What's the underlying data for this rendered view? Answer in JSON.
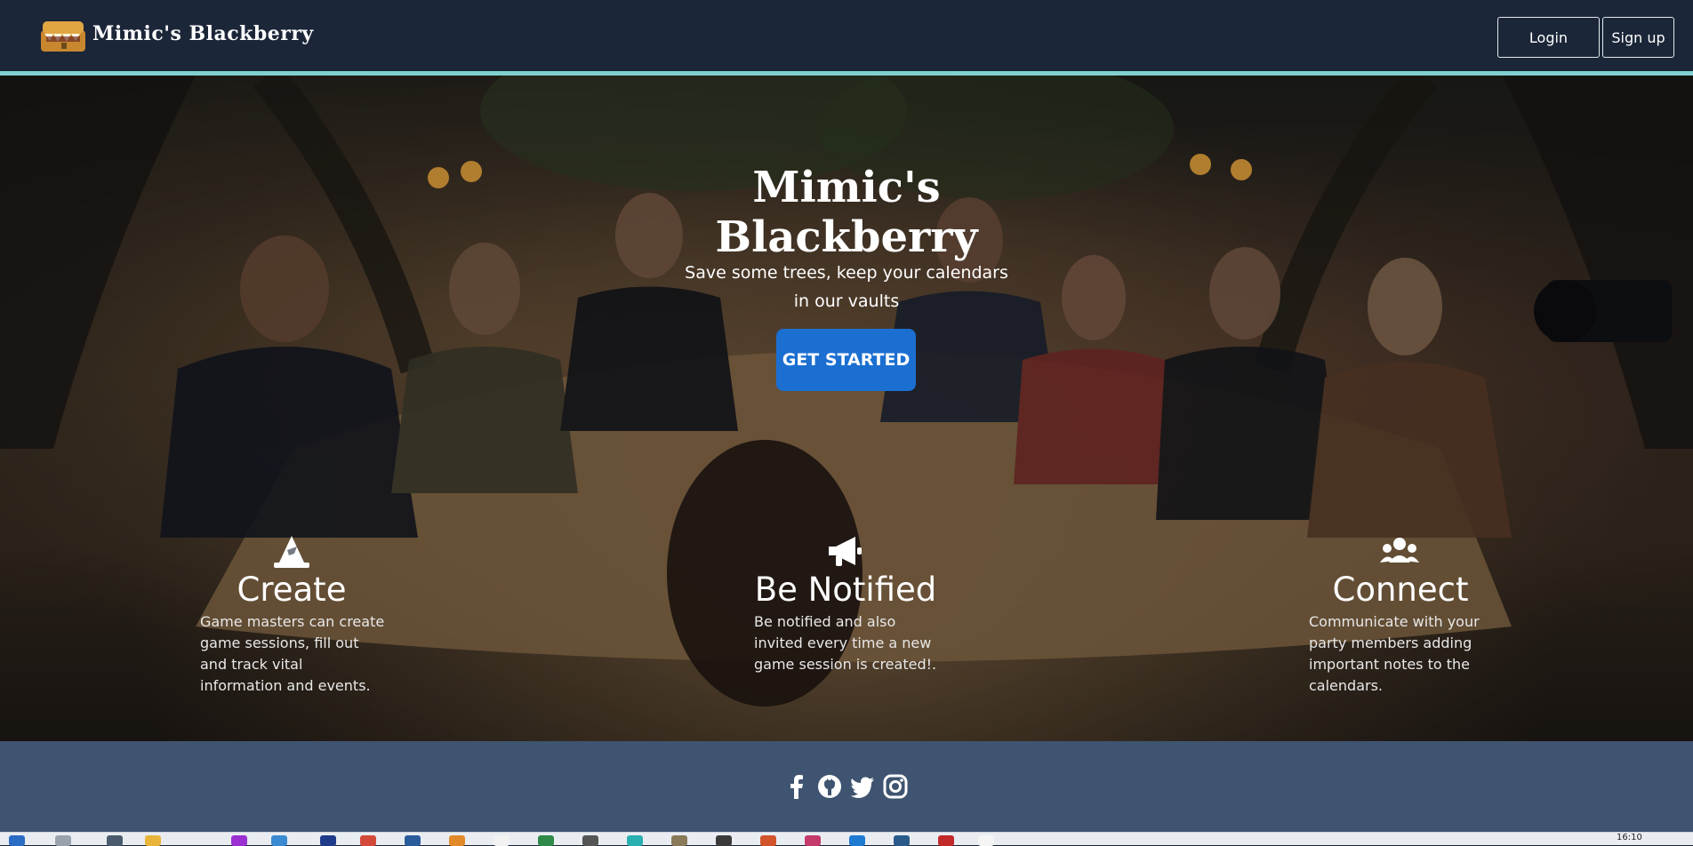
{
  "header": {
    "brand": "Mimic's Blackberry",
    "login_label": "Login",
    "signup_label": "Sign up"
  },
  "hero": {
    "title_line1": "Mimic's",
    "title_line2": "Blackberry",
    "subtitle_line1": "Save some trees, keep your calendars",
    "subtitle_line2": "in our vaults",
    "cta_label": "GET STARTED"
  },
  "features": [
    {
      "icon": "wizard-hat-icon",
      "title": "Create",
      "lines": [
        "Game masters can create",
        "game sessions, fill out",
        "and track vital",
        "information and events."
      ]
    },
    {
      "icon": "megaphone-icon",
      "title": "Be Notified",
      "lines": [
        "Be notified and also",
        "invited every time a new",
        "game session is created!."
      ]
    },
    {
      "icon": "users-icon",
      "title": "Connect",
      "lines": [
        "Communicate with your",
        "party members adding",
        "important notes to the",
        "calendars."
      ]
    }
  ],
  "footer": {
    "social_icons": [
      "facebook-icon",
      "github-icon",
      "twitter-icon",
      "instagram-icon"
    ]
  },
  "taskbar": {
    "clock": "16:10"
  },
  "colors": {
    "header_bg": "#1b2638",
    "accent_line": "#7fd0cf",
    "cta_blue": "#1b6fd1",
    "footer_bg": "#3f5470"
  }
}
